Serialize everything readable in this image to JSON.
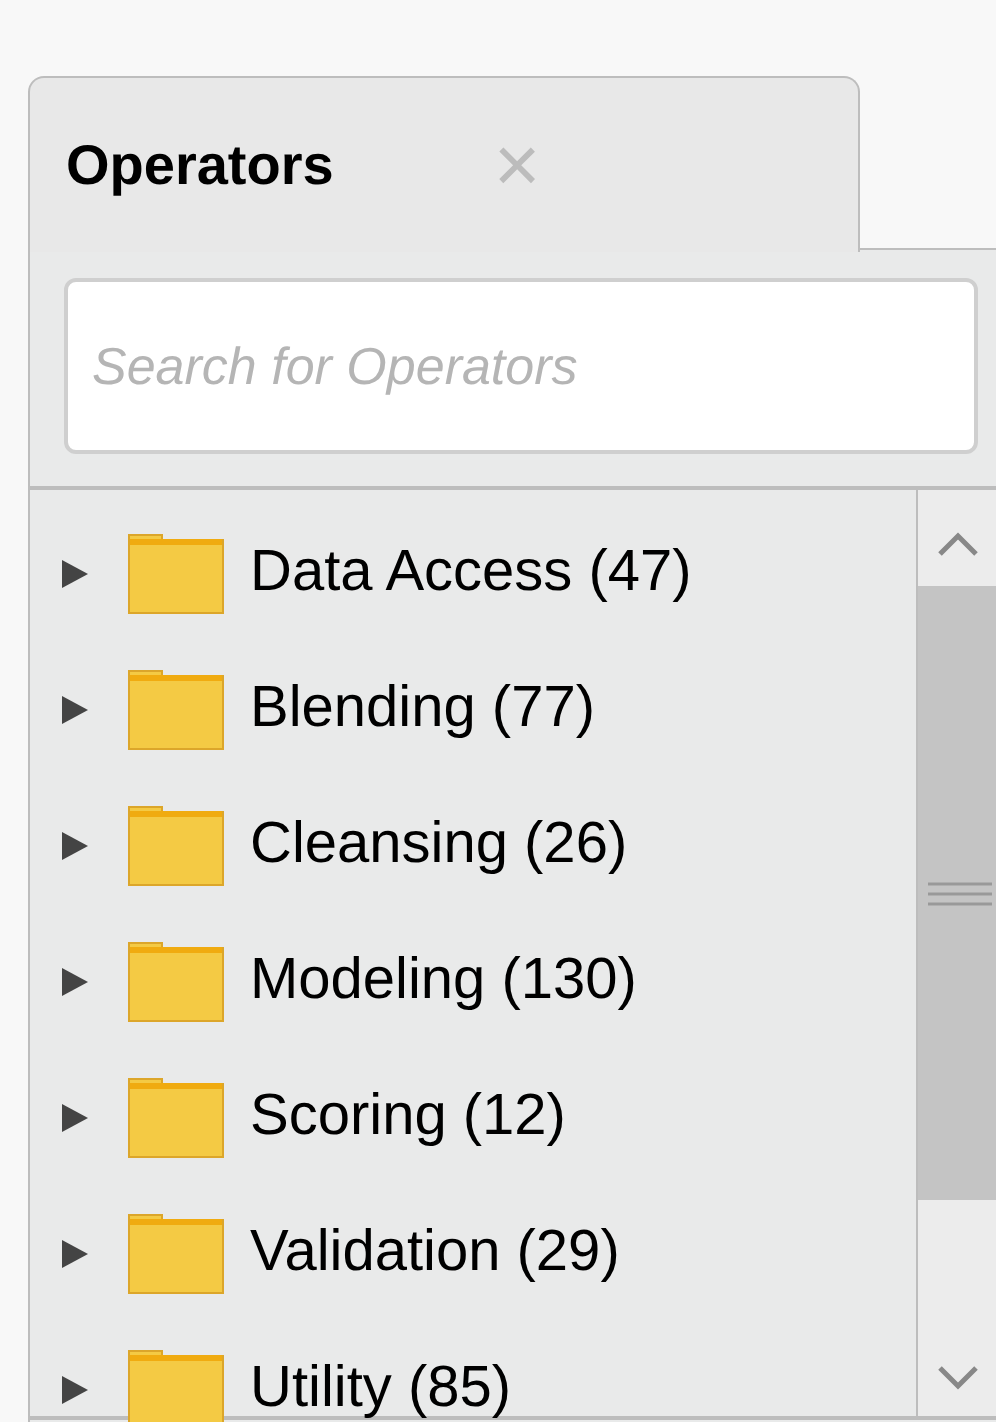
{
  "panel": {
    "tab": {
      "label": "Operators",
      "close": "×"
    },
    "search": {
      "placeholder": "Search for Operators"
    },
    "tree": [
      {
        "label": "Data Access (47)",
        "expanded": false
      },
      {
        "label": "Blending (77)",
        "expanded": false
      },
      {
        "label": "Cleansing (26)",
        "expanded": false
      },
      {
        "label": "Modeling (130)",
        "expanded": false
      },
      {
        "label": "Scoring (12)",
        "expanded": false
      },
      {
        "label": "Validation (29)",
        "expanded": false
      },
      {
        "label": "Utility (85)",
        "expanded": false
      }
    ]
  }
}
